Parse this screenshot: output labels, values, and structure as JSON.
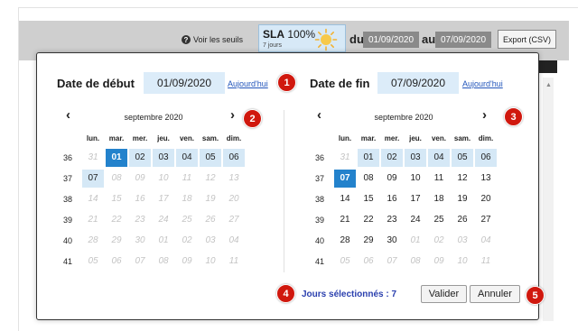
{
  "toolbar": {
    "help_label": "Voir les seuils",
    "sla_title": "SLA",
    "sla_value": "100%",
    "sla_period": "7 jours",
    "range_from_label": "du",
    "range_from": "01/09/2020",
    "range_to_label": "au",
    "range_to": "07/09/2020",
    "export_label": "Export (CSV)"
  },
  "start": {
    "label": "Date de début",
    "value": "01/09/2020",
    "today_label": "Aujourd'hui",
    "month_title": "septembre 2020",
    "prev_arrow": "‹",
    "next_arrow": "›"
  },
  "end": {
    "label": "Date de fin",
    "value": "07/09/2020",
    "today_label": "Aujourd'hui",
    "month_title": "septembre 2020",
    "prev_arrow": "‹",
    "next_arrow": "›"
  },
  "weekdays": [
    "lun.",
    "mar.",
    "mer.",
    "jeu.",
    "ven.",
    "sam.",
    "dim."
  ],
  "calendars": {
    "start": {
      "weeks": [
        {
          "num": "36",
          "days": [
            "31",
            "01",
            "02",
            "03",
            "04",
            "05",
            "06"
          ],
          "state": [
            "out",
            "sel-first",
            "sel",
            "sel",
            "sel",
            "sel",
            "sel"
          ]
        },
        {
          "num": "37",
          "days": [
            "07",
            "08",
            "09",
            "10",
            "11",
            "12",
            "13"
          ],
          "state": [
            "sel",
            "out",
            "out",
            "out",
            "out",
            "out",
            "out"
          ]
        },
        {
          "num": "38",
          "days": [
            "14",
            "15",
            "16",
            "17",
            "18",
            "19",
            "20"
          ],
          "state": [
            "out",
            "out",
            "out",
            "out",
            "out",
            "out",
            "out"
          ]
        },
        {
          "num": "39",
          "days": [
            "21",
            "22",
            "23",
            "24",
            "25",
            "26",
            "27"
          ],
          "state": [
            "out",
            "out",
            "out",
            "out",
            "out",
            "out",
            "out"
          ]
        },
        {
          "num": "40",
          "days": [
            "28",
            "29",
            "30",
            "01",
            "02",
            "03",
            "04"
          ],
          "state": [
            "out",
            "out",
            "out",
            "out",
            "out",
            "out",
            "out"
          ]
        },
        {
          "num": "41",
          "days": [
            "05",
            "06",
            "07",
            "08",
            "09",
            "10",
            "11"
          ],
          "state": [
            "out",
            "out",
            "out",
            "out",
            "out",
            "out",
            "out"
          ]
        }
      ]
    },
    "end": {
      "weeks": [
        {
          "num": "36",
          "days": [
            "31",
            "01",
            "02",
            "03",
            "04",
            "05",
            "06"
          ],
          "state": [
            "out",
            "sel",
            "sel",
            "sel",
            "sel",
            "sel",
            "sel"
          ]
        },
        {
          "num": "37",
          "days": [
            "07",
            "08",
            "09",
            "10",
            "11",
            "12",
            "13"
          ],
          "state": [
            "sel-first",
            "in",
            "in",
            "in",
            "in",
            "in",
            "in"
          ]
        },
        {
          "num": "38",
          "days": [
            "14",
            "15",
            "16",
            "17",
            "18",
            "19",
            "20"
          ],
          "state": [
            "in",
            "in",
            "in",
            "in",
            "in",
            "in",
            "in"
          ]
        },
        {
          "num": "39",
          "days": [
            "21",
            "22",
            "23",
            "24",
            "25",
            "26",
            "27"
          ],
          "state": [
            "in",
            "in",
            "in",
            "in",
            "in",
            "in",
            "in"
          ]
        },
        {
          "num": "40",
          "days": [
            "28",
            "29",
            "30",
            "01",
            "02",
            "03",
            "04"
          ],
          "state": [
            "in",
            "in",
            "in",
            "out",
            "out",
            "out",
            "out"
          ]
        },
        {
          "num": "41",
          "days": [
            "05",
            "06",
            "07",
            "08",
            "09",
            "10",
            "11"
          ],
          "state": [
            "out",
            "out",
            "out",
            "out",
            "out",
            "out",
            "out"
          ]
        }
      ]
    }
  },
  "footer": {
    "selected_label": "Jours sélectionnés : 7",
    "validate_label": "Valider",
    "cancel_label": "Annuler"
  },
  "badges": [
    "1",
    "2",
    "3",
    "4",
    "5"
  ],
  "colors": {
    "selected_day": "#2382cc",
    "range_day": "#d5e8f6",
    "badge": "#d0180e",
    "link": "#2255bb"
  }
}
